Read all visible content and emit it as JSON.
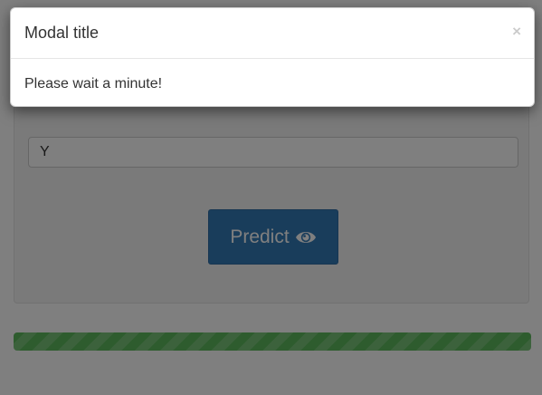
{
  "modal": {
    "title": "Modal title",
    "close_label": "×",
    "body_text": "Please wait a minute!"
  },
  "form": {
    "input_value": "Y",
    "predict_label": "Predict",
    "predict_icon": "eye-icon"
  },
  "progress": {
    "fraction": 1.0,
    "style": "striped",
    "color": "#5cb85c"
  },
  "colors": {
    "primary": "#337ab7",
    "success": "#5cb85c"
  }
}
